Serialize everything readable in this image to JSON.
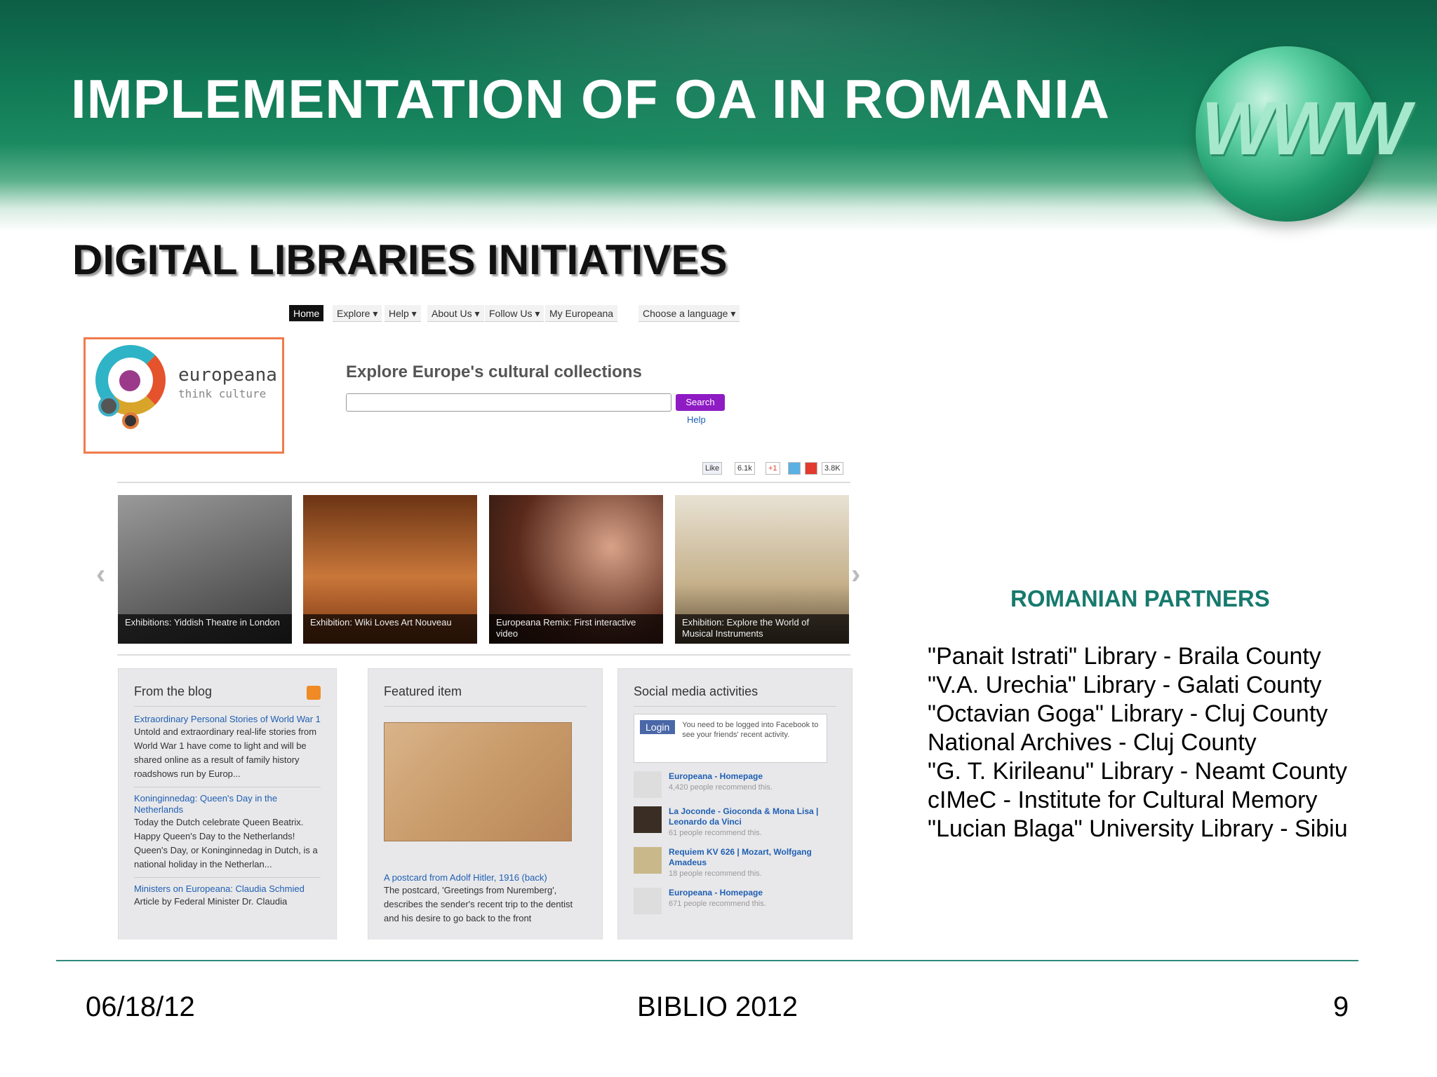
{
  "slide": {
    "title": "IMPLEMENTATION OF OA IN ROMANIA",
    "globe_text": "WWW",
    "section_title": "DIGITAL LIBRARIES INITIATIVES"
  },
  "europeana": {
    "nav": [
      {
        "label": "Home",
        "active": true
      },
      {
        "label": "Explore ▾"
      },
      {
        "label": "Help ▾"
      },
      {
        "label": "About Us ▾"
      },
      {
        "label": "Follow Us ▾"
      },
      {
        "label": "My Europeana"
      }
    ],
    "language": "Choose a language ▾",
    "logo": {
      "word": "europeana",
      "tagline": "think culture"
    },
    "explore_title": "Explore Europe's cultural collections",
    "search": {
      "value": "",
      "button": "Search",
      "help": "Help"
    },
    "social_counts": {
      "like": "Like",
      "like_count": "6.1k",
      "plus": "+1",
      "share_count": "3.8K"
    },
    "carousel": [
      {
        "caption": "Exhibitions: Yiddish Theatre in London",
        "color": "#6b6b6b"
      },
      {
        "caption": "Exhibition: Wiki Loves Art Nouveau",
        "color": "#8a4a1e"
      },
      {
        "caption": "Europeana Remix: First interactive video",
        "color": "#4a2a1c"
      },
      {
        "caption": "Exhibition: Explore the World of Musical Instruments",
        "color": "#b39a6e"
      }
    ],
    "blog": {
      "heading": "From the blog",
      "entries": [
        {
          "link": "Extraordinary Personal Stories of World War 1",
          "text": "Untold and extraordinary real-life stories from World War 1 have come to light and will be shared online as a result of family history roadshows run by Europ..."
        },
        {
          "link": "Koninginnedag: Queen's Day in the Netherlands",
          "text": "Today the Dutch celebrate Queen Beatrix. Happy Queen's Day to the Netherlands! Queen's Day, or Koninginnedag in Dutch, is a national holiday in the Netherlan..."
        },
        {
          "link": "Ministers on Europeana: Claudia Schmied",
          "text": "Article by Federal Minister Dr. Claudia"
        }
      ]
    },
    "featured": {
      "heading": "Featured item",
      "link": "A postcard from Adolf Hitler, 1916 (back)",
      "text": "The postcard, 'Greetings from Nuremberg', describes the sender's recent trip to the dentist and his desire to go back to the front"
    },
    "social": {
      "heading": "Social media activities",
      "login_button": "Login",
      "login_text": "You need to be logged into Facebook to see your friends' recent activity.",
      "activities": [
        {
          "title": "Europeana - Homepage",
          "meta": "4,420 people recommend this."
        },
        {
          "title": "La Joconde - Gioconda & Mona Lisa | Leonardo da Vinci",
          "meta": "61 people recommend this."
        },
        {
          "title": "Requiem KV 626 | Mozart, Wolfgang Amadeus",
          "meta": "18 people recommend this."
        },
        {
          "title": "Europeana - Homepage",
          "meta": "671 people recommend this."
        }
      ]
    }
  },
  "partners": {
    "heading": "ROMANIAN PARTNERS",
    "items": [
      "\"Panait Istrati\" Library - Braila County",
      "\"V.A. Urechia\" Library - Galati County",
      "\"Octavian Goga\" Library - Cluj County",
      "National Archives - Cluj County",
      "\"G. T. Kirileanu\" Library - Neamt County",
      "cIMeC - Institute for Cultural Memory",
      "\"Lucian Blaga\" University Library - Sibiu"
    ]
  },
  "footer": {
    "date": "06/18/12",
    "center": "BIBLIO 2012",
    "page": "9"
  }
}
